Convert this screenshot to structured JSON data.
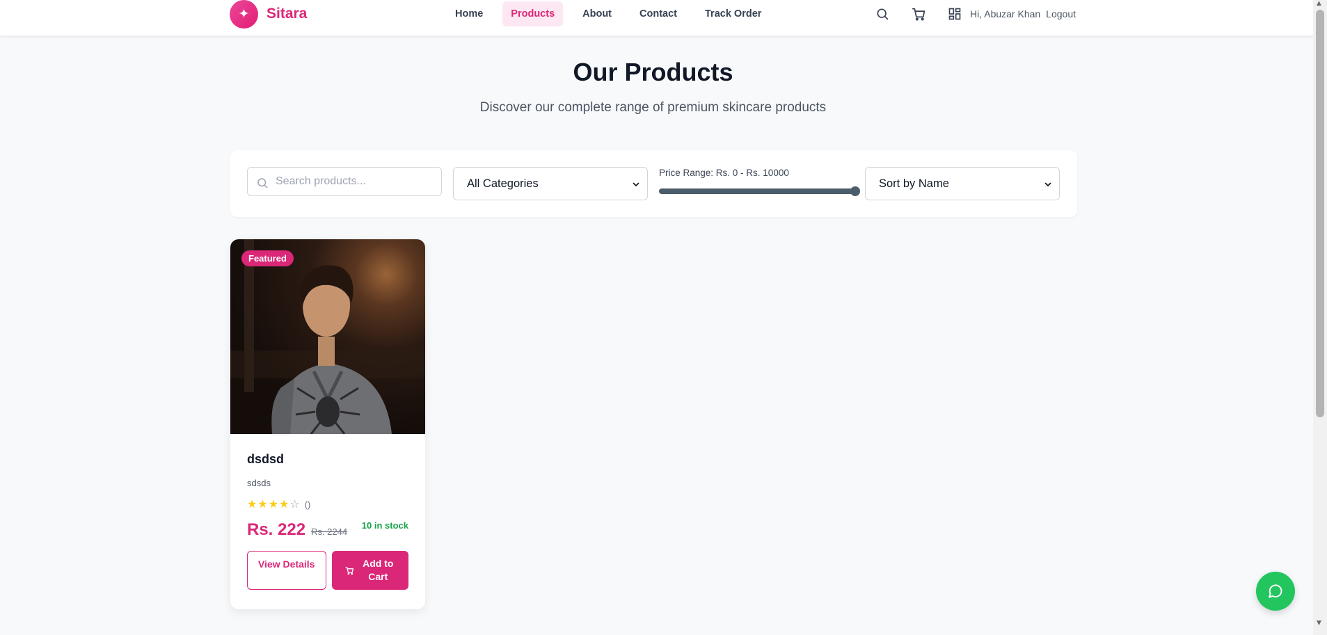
{
  "brand": {
    "name": "Sitara",
    "logo_glyph": "✦",
    "accent_color": "#db2777"
  },
  "nav": {
    "items": [
      {
        "label": "Home",
        "active": false
      },
      {
        "label": "Products",
        "active": true
      },
      {
        "label": "About",
        "active": false
      },
      {
        "label": "Contact",
        "active": false
      },
      {
        "label": "Track Order",
        "active": false
      }
    ]
  },
  "header": {
    "icons": [
      "search-icon",
      "cart-icon",
      "dashboard-icon"
    ],
    "greeting": "Hi, Abuzar Khan",
    "logout_label": "Logout"
  },
  "page": {
    "title": "Our Products",
    "subtitle": "Discover our complete range of premium skincare products"
  },
  "filters": {
    "search_placeholder": "Search products...",
    "search_value": "",
    "category_selected": "All Categories",
    "price_label": "Price Range: Rs. 0 - Rs. 10000",
    "price_max_value": 10000,
    "price_slider_fraction": 1.0,
    "sort_selected": "Sort by Name"
  },
  "products": [
    {
      "badge": "Featured",
      "name": "dsdsd",
      "description": "sdsds",
      "rating_stars": 4,
      "rating_max": 5,
      "rating_count": "()",
      "price": "Rs. 222",
      "original_price": "Rs. 2244",
      "stock": "10 in stock",
      "view_label": "View Details",
      "add_label": "Add to Cart"
    }
  ],
  "colors": {
    "primary": "#db2777",
    "stock_green": "#16a34a",
    "chat_green": "#22c55e",
    "star_yellow": "#facc15"
  }
}
